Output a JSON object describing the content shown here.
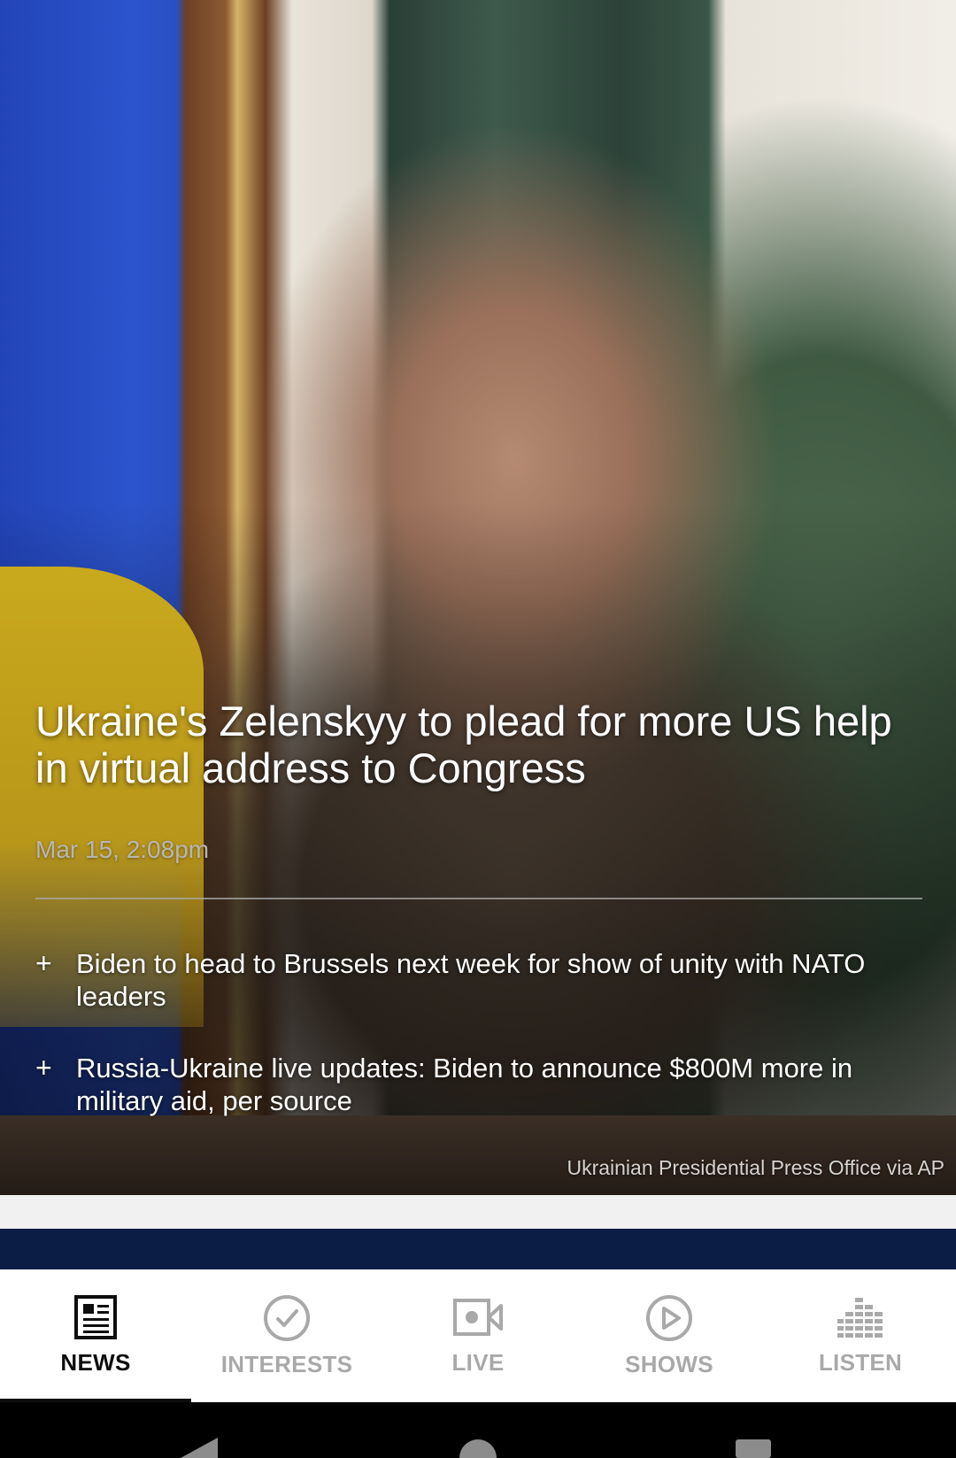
{
  "hero": {
    "headline": "Ukraine's Zelenskyy to plead for more US help in virtual address to Congress",
    "timestamp": "Mar 15, 2:08pm",
    "related": [
      "Biden to head to Brussels next week for show of unity with NATO leaders",
      "Russia-Ukraine live updates: Biden to announce $800M more in military aid, per source"
    ],
    "photo_credit": "Ukrainian Presidential Press Office via AP",
    "plus_symbol": "+"
  },
  "tabs": [
    {
      "label": "NEWS",
      "icon": "newspaper-icon",
      "active": true
    },
    {
      "label": "INTERESTS",
      "icon": "check-circle-icon",
      "active": false
    },
    {
      "label": "LIVE",
      "icon": "video-camera-icon",
      "active": false
    },
    {
      "label": "SHOWS",
      "icon": "play-circle-icon",
      "active": false
    },
    {
      "label": "LISTEN",
      "icon": "audio-bars-icon",
      "active": false
    }
  ],
  "colors": {
    "active_tab": "#0d0d0d",
    "inactive_tab": "#a9a9a9",
    "next_card": "#0b1d44"
  }
}
